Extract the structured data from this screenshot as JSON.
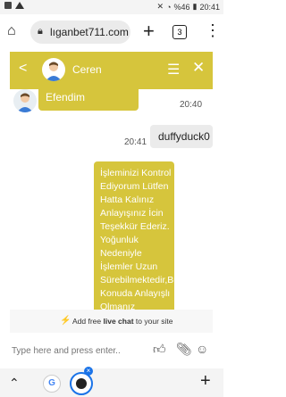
{
  "status_bar": {
    "battery": "%46",
    "time": "20:41"
  },
  "browser": {
    "url": "lıganbet711.com",
    "tab_count": "3"
  },
  "chat": {
    "agent_name": "Ceren",
    "accent_color": "#d6c53c",
    "messages": [
      {
        "side": "in",
        "text": "Efendim",
        "time": "20:40"
      },
      {
        "side": "out",
        "text": "duffyduck0",
        "time": "20:41"
      },
      {
        "side": "in",
        "text": "İşleminizi Kontrol Ediyorum Lütfen Hatta Kalınız Anlayışınız İcin Teşekkür Ederiz. Yoğunluk Nedeniyle İşlemler Uzun Sürebilmektedir,Bu Konuda Anlayışlı Olmanız Teşekkür"
      }
    ],
    "footer_prefix": "Add free",
    "footer_bold": "live chat",
    "footer_suffix": "to your site",
    "input_placeholder": "Type here and press enter.."
  }
}
